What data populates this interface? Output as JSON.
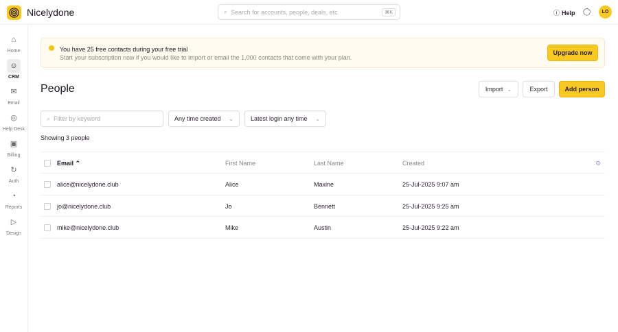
{
  "app": {
    "name": "Nicelydone",
    "search_placeholder": "Search for accounts, people, deals, etc",
    "search_shortcut": "⌘K",
    "help": "Help",
    "avatar": "LO",
    "accent": "#f8c823"
  },
  "sidebar": {
    "items": [
      {
        "label": "Home",
        "icon": "home-icon"
      },
      {
        "label": "CRM",
        "icon": "crm-icon",
        "active": true
      },
      {
        "label": "Email",
        "icon": "email-icon"
      },
      {
        "label": "Help Desk",
        "icon": "help-desk-icon"
      },
      {
        "label": "Billing",
        "icon": "billing-icon"
      },
      {
        "label": "Auth",
        "icon": "auth-icon"
      },
      {
        "label": "Reports",
        "icon": "reports-icon"
      },
      {
        "label": "Design",
        "icon": "design-icon"
      }
    ]
  },
  "banner": {
    "title": "You have 25 free contacts during your free trial",
    "subtitle": "Start your subscription now if you would like to import or email the 1,000 contacts that come with your plan.",
    "button": "Upgrade now"
  },
  "page": {
    "title": "People",
    "import": "Import",
    "export": "Export",
    "add": "Add person"
  },
  "filters": {
    "keyword_placeholder": "Filter by keyword",
    "created": "Any time created",
    "login": "Latest login any time"
  },
  "showing": "Showing 3 people",
  "table": {
    "headers": [
      "Email ⌃",
      "First Name",
      "Last Name",
      "Created"
    ],
    "rows": [
      [
        "alice@nicelydone.club",
        "Alice",
        "Maxine",
        "25-Jul-2025 9:07 am"
      ],
      [
        "jo@nicelydone.club",
        "Jo",
        "Bennett",
        "25-Jul-2025 9:25 am"
      ],
      [
        "mike@nicelydone.club",
        "Mike",
        "Austin",
        "25-Jul-2025 9:22 am"
      ]
    ]
  }
}
